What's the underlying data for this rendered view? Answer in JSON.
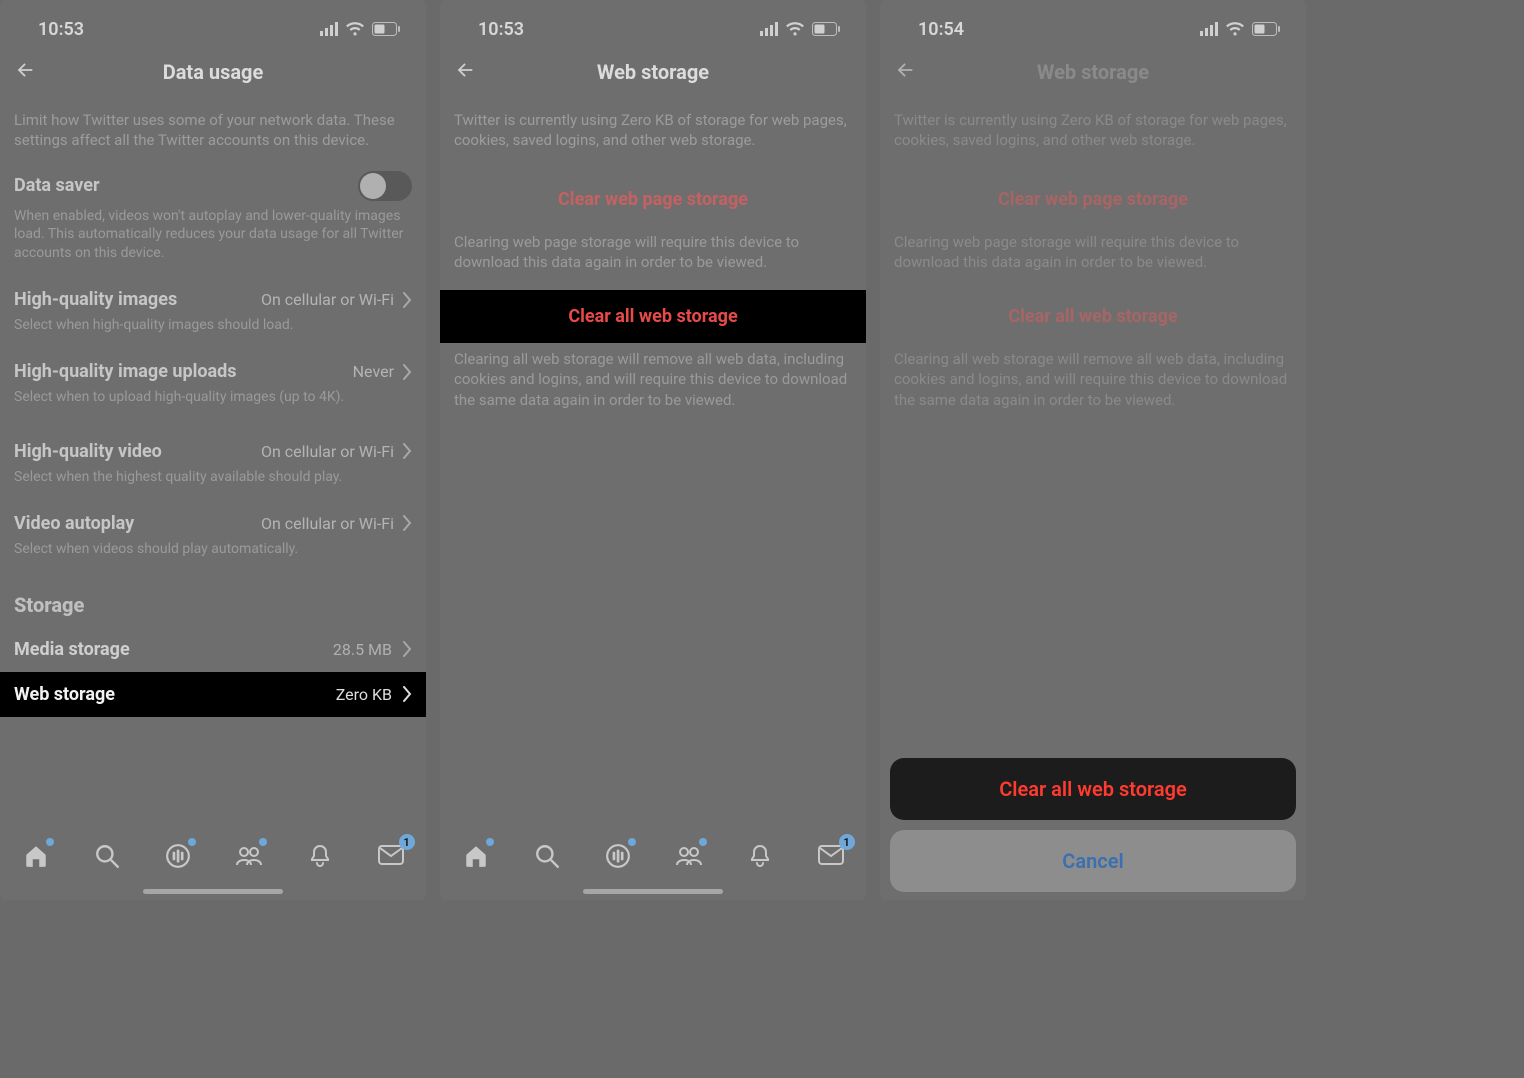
{
  "status": {
    "time_a": "10:53",
    "time_b": "10:53",
    "time_c": "10:54"
  },
  "screen1": {
    "title": "Data usage",
    "intro": "Limit how Twitter uses some of your network data. These settings affect all the Twitter accounts on this device.",
    "data_saver": {
      "label": "Data saver",
      "desc": "When enabled, videos won't autoplay and lower-quality images load. This automatically reduces your data usage for all Twitter accounts on this device."
    },
    "hq_images": {
      "label": "High-quality images",
      "value": "On cellular or Wi-Fi",
      "desc": "Select when high-quality images should load."
    },
    "hq_uploads": {
      "label": "High-quality image uploads",
      "value": "Never",
      "desc": "Select when to upload high-quality images (up to 4K)."
    },
    "hq_video": {
      "label": "High-quality video",
      "value": "On cellular or Wi-Fi",
      "desc": "Select when the highest quality available should play."
    },
    "autoplay": {
      "label": "Video autoplay",
      "value": "On cellular or Wi-Fi",
      "desc": "Select when videos should play automatically."
    },
    "storage_heading": "Storage",
    "media_storage": {
      "label": "Media storage",
      "value": "28.5 MB"
    },
    "web_storage": {
      "label": "Web storage",
      "value": "Zero KB"
    },
    "tabbar": {
      "msg_badge": "1"
    }
  },
  "screen2": {
    "title": "Web storage",
    "intro": "Twitter is currently using Zero KB of storage for web pages, cookies, saved logins, and other web storage.",
    "clear_page": {
      "label": "Clear web page storage",
      "desc": "Clearing web page storage will require this device to download this data again in order to be viewed."
    },
    "clear_all": {
      "label": "Clear all web storage",
      "desc": "Clearing all web storage will remove all web data, including cookies and logins, and will require this device to download the same data again in order to be viewed."
    },
    "tabbar": {
      "msg_badge": "1"
    }
  },
  "screen3": {
    "title": "Web storage",
    "intro": "Twitter is currently using Zero KB of storage for web pages, cookies, saved logins, and other web storage.",
    "clear_page": {
      "label": "Clear web page storage",
      "desc": "Clearing web page storage will require this device to download this data again in order to be viewed."
    },
    "clear_all": {
      "label": "Clear all web storage",
      "desc": "Clearing all web storage will remove all web data, including cookies and logins, and will require this device to download the same data again in order to be viewed."
    },
    "sheet": {
      "destructive": "Clear all web storage",
      "cancel": "Cancel"
    }
  }
}
